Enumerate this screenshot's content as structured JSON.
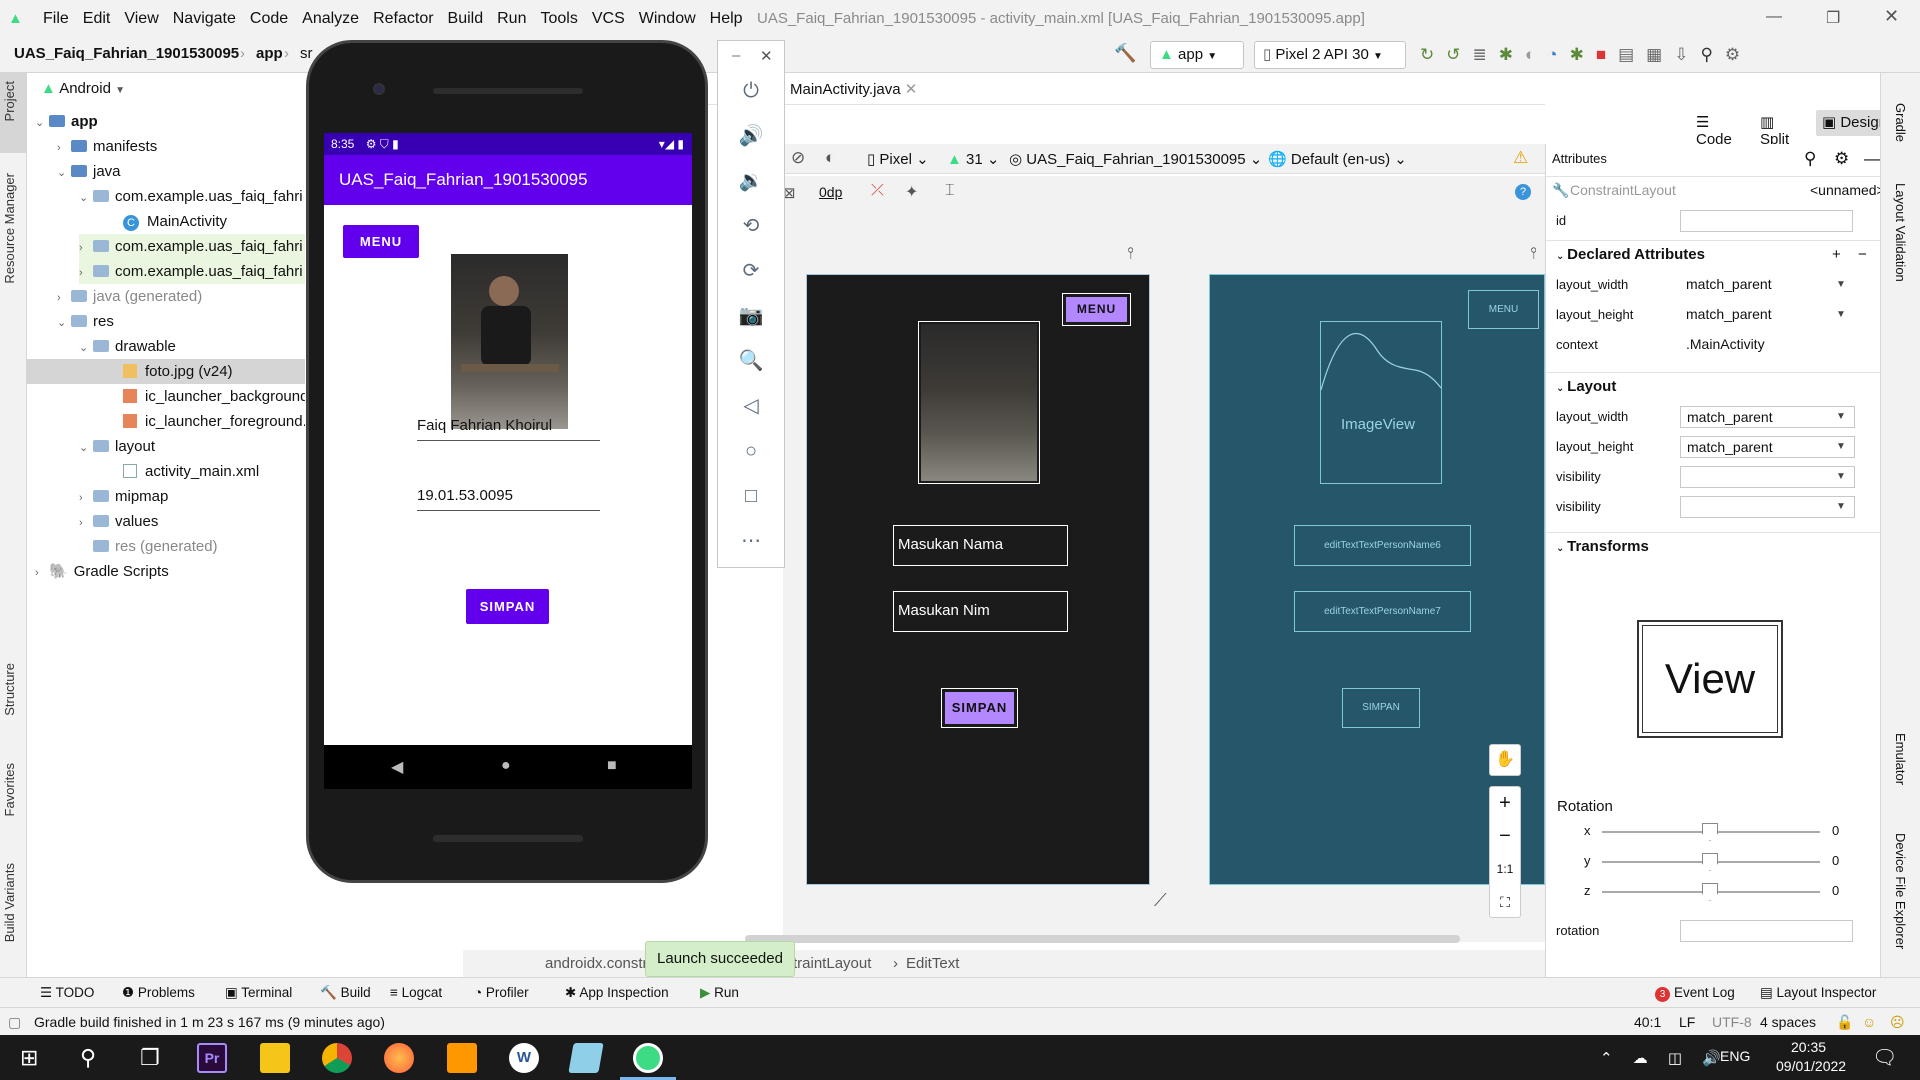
{
  "menu": {
    "items": [
      "File",
      "Edit",
      "View",
      "Navigate",
      "Code",
      "Analyze",
      "Refactor",
      "Build",
      "Run",
      "Tools",
      "VCS",
      "Window",
      "Help"
    ],
    "window_title": "UAS_Faiq_Fahrian_1901530095 - activity_main.xml [UAS_Faiq_Fahrian_1901530095.app]"
  },
  "breadcrumb": {
    "project": "UAS_Faiq_Fahrian_1901530095",
    "module": "app",
    "next": "sr"
  },
  "toolbar": {
    "run_config": "app",
    "device": "Pixel 2 API 30"
  },
  "project_panel": {
    "view": "Android",
    "tree": [
      {
        "label": "app",
        "level": 0,
        "bold": true
      },
      {
        "label": "manifests",
        "level": 1
      },
      {
        "label": "java",
        "level": 1
      },
      {
        "label": "com.example.uas_faiq_fahri",
        "level": 2
      },
      {
        "label": "MainActivity",
        "level": 3
      },
      {
        "label": "com.example.uas_faiq_fahri",
        "level": 2
      },
      {
        "label": "com.example.uas_faiq_fahri",
        "level": 2
      },
      {
        "label": "java (generated)",
        "level": 1
      },
      {
        "label": "res",
        "level": 1
      },
      {
        "label": "drawable",
        "level": 2
      },
      {
        "label": "foto.jpg (v24)",
        "level": 3
      },
      {
        "label": "ic_launcher_background",
        "level": 3
      },
      {
        "label": "ic_launcher_foreground.",
        "level": 3
      },
      {
        "label": "layout",
        "level": 2
      },
      {
        "label": "activity_main.xml",
        "level": 3
      },
      {
        "label": "mipmap",
        "level": 2
      },
      {
        "label": "values",
        "level": 2
      },
      {
        "label": "res (generated)",
        "level": 1
      },
      {
        "label": "Gradle Scripts",
        "level": 0
      }
    ]
  },
  "left_tools": [
    "Project",
    "Resource Manager",
    "Structure",
    "Favorites",
    "Build Variants"
  ],
  "right_tools": [
    "Gradle",
    "Layout Validation",
    "Emulator",
    "Device File Explorer"
  ],
  "phone": {
    "time": "8:35",
    "app_title": "UAS_Faiq_Fahrian_1901530095",
    "menu_button": "MENU",
    "name_value": "Faiq Fahrian Khoirul",
    "nim_value": "19.01.53.0095",
    "save_button": "SIMPAN"
  },
  "editor": {
    "tab": "MainActivity.java",
    "views": [
      "Code",
      "Split",
      "Design"
    ],
    "device": "Pixel",
    "api": "31",
    "theme": "UAS_Faiq_Fahrian_1901530095",
    "locale": "Default (en-us)",
    "margin": "0dp"
  },
  "design": {
    "menu": "MENU",
    "name_hint": "Masukan Nama",
    "nim_hint": "Masukan Nim",
    "save": "SIMPAN"
  },
  "blueprint": {
    "menu": "MENU",
    "image": "ImageView",
    "edit1": "editTextTextPersonName6",
    "edit2": "editTextTextPersonName7",
    "save": "SIMPAN"
  },
  "component_tree": [
    "androidx.constr",
    "traintLayout",
    "EditText"
  ],
  "toast": "Launch succeeded",
  "attributes": {
    "title": "Attributes",
    "component": "ConstraintLayout",
    "name": "<unnamed>",
    "id_label": "id",
    "declared": "Declared Attributes",
    "layout": "Layout",
    "transforms": "Transforms",
    "declared_rows": [
      {
        "k": "layout_width",
        "v": "match_parent"
      },
      {
        "k": "layout_height",
        "v": "match_parent"
      },
      {
        "k": "context",
        "v": ".MainActivity"
      }
    ],
    "layout_rows": [
      {
        "k": "layout_width",
        "v": "match_parent"
      },
      {
        "k": "layout_height",
        "v": "match_parent"
      },
      {
        "k": "visibility",
        "v": ""
      },
      {
        "k": "visibility",
        "v": ""
      }
    ],
    "view_label": "View",
    "rotation_label": "Rotation",
    "axes": [
      {
        "axis": "x",
        "value": "0"
      },
      {
        "axis": "y",
        "value": "0"
      },
      {
        "axis": "z",
        "value": "0"
      }
    ],
    "rotation_field": "rotation"
  },
  "bottom_tools": [
    "TODO",
    "Problems",
    "Terminal",
    "Build",
    "Logcat",
    "Profiler",
    "App Inspection",
    "Run",
    "Event Log",
    "Layout Inspector"
  ],
  "event_count": "3",
  "status": {
    "message": "Gradle build finished in 1 m 23 s 167 ms (9 minutes ago)",
    "position": "40:1",
    "line_sep": "LF",
    "encoding": "UTF-8",
    "indent": "4 spaces"
  },
  "taskbar": {
    "lang": "ENG",
    "time": "20:35",
    "date": "09/01/2022"
  },
  "colors": {
    "accent": "#6200ee",
    "purple_btn": "#b388ff",
    "blueprint": "#25566a"
  }
}
